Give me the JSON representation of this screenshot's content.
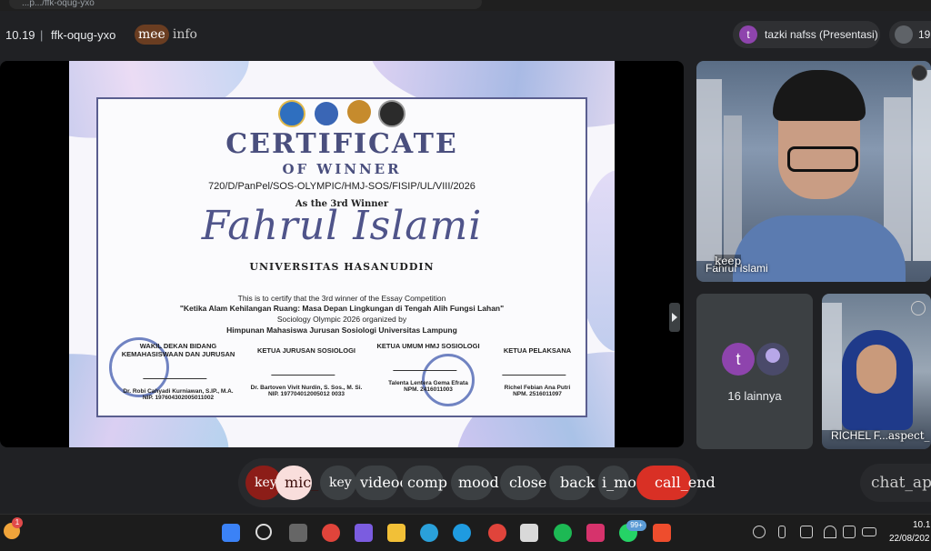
{
  "browser": {
    "url_fragment": "...p.../ffk-oqug-yxo"
  },
  "topbar": {
    "clock": "10.19",
    "separator": "|",
    "meeting_code": "ffk-oqug-yxo",
    "mee_label": "mee",
    "info_label": "info",
    "presenter_initial": "t",
    "presenter_chip": "tazki nafss (Presentasi)",
    "people_count": "19"
  },
  "certificate": {
    "title": "CERTIFICATE",
    "subtitle": "OF WINNER",
    "number": "720/D/PanPel/SOS-OLYMPIC/HMJ-SOS/FISIP/UL/VIII/2026",
    "as_the": "As the 3rd Winner",
    "winner_name": "Fahrul Islami",
    "university": "UNIVERSITAS HASANUDDIN",
    "line1": "This is to certify that the 3rd winner of the Essay Competition",
    "line2": "\"Ketika Alam Kehilangan Ruang: Masa Depan Lingkungan di Tengah Alih Fungsi Lahan\"",
    "line3": "Sociology Olympic 2026 organized by",
    "line4": "Himpunan Mahasiswa Jurusan Sosiologi Universitas Lampung",
    "signatories": [
      {
        "role": "WAKIL DEKAN BIDANG KEMAHASISWAAN DAN JURUSAN",
        "name": "Dr. Robi Cahyadi Kurniawan, S.IP., M.A.",
        "id": "NIP. 197604302005011002"
      },
      {
        "role": "KETUA JURUSAN SOSIOLOGI",
        "name": "Dr. Bartoven Vivit Nurdin, S. Sos., M. Si.",
        "id": "NIP. 197704012005012 0033"
      },
      {
        "role": "KETUA UMUM HMJ SOSIOLOGI",
        "name": "Talenta Lentera Gema Efrata",
        "id": "NPM. 2416011003"
      },
      {
        "role": "KETUA PELAKSANA",
        "name": "Richel Febian Ana Putri",
        "id": "NPM. 2516011097"
      }
    ]
  },
  "tiles": {
    "main_tile_keep": "keep",
    "main_tile_name": "Fahrul Islami",
    "others_initial": "t",
    "others_label": "16 lainnya",
    "third_tile_name": "RICHEL F...",
    "third_tile_aspect": "aspect_"
  },
  "controls": {
    "key1": "key",
    "mic": "mic_",
    "key2": "key",
    "video": "videocam",
    "comp": "comp",
    "mood": "mood",
    "close": "close",
    "back": "back",
    "more": "i_mo",
    "end": "call_end",
    "chat": "chat_app"
  },
  "taskbar": {
    "weather_badge": "1",
    "whatsapp_badge": "99+",
    "time": "10.1",
    "date": "22/08/202"
  },
  "colors": {
    "background": "#202124",
    "end_call": "#d93025",
    "mic_muted": "#f9dedc",
    "certificate_accent": "#4a4f7e"
  }
}
